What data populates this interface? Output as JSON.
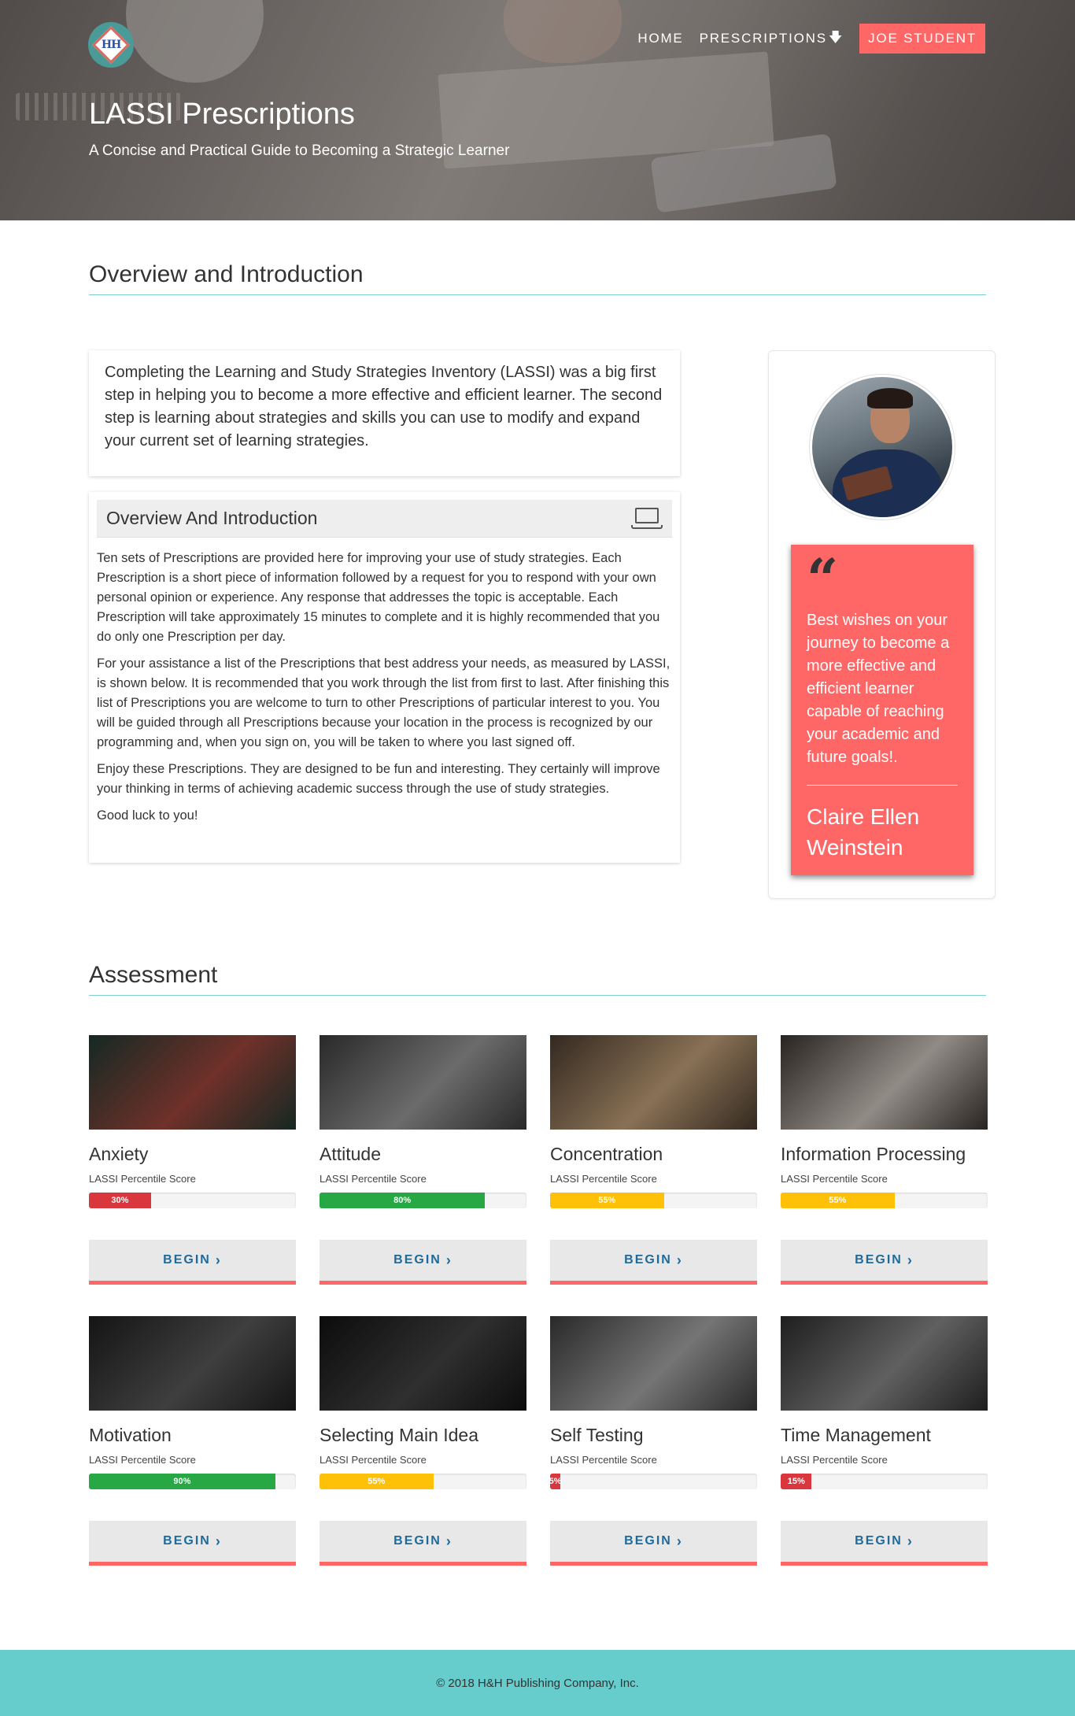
{
  "brand": {
    "logo_text": "HH",
    "logo_icon": "hh-logo-icon"
  },
  "nav": {
    "home": "HOME",
    "prescriptions": "PRESCRIPTIONS",
    "prescriptions_icon": "arrow-down-icon",
    "user": "JOE STUDENT"
  },
  "hero": {
    "title": "LASSI Prescriptions",
    "subtitle": "A Concise and Practical Guide to Becoming a Strategic Learner"
  },
  "intro": {
    "section_title": "Overview and Introduction",
    "lead": "Completing the Learning and Study Strategies Inventory (LASSI) was a big first step in helping you to become a more effective and efficient learner. The second step is learning about strategies and skills you can use to modify and expand your current set of learning strategies.",
    "card_title": "Overview And Introduction",
    "card_icon": "laptop-icon",
    "paragraphs": [
      "Ten sets of Prescriptions are provided here for improving your use of study strategies. Each Prescription is a short piece of information followed by a request for you to respond with your own personal opinion or experience. Any response that addresses the topic is acceptable. Each Prescription will take approximately 15 minutes to complete and it is highly recommended that you do only one Prescription per day.",
      "For your assistance a list of the Prescriptions that best address your needs, as measured by LASSI, is shown below. It is recommended that you work through the list from first to last. After finishing this list of Prescriptions you are welcome to turn to other Prescriptions of particular interest to you. You will be guided through all Prescriptions because your location in the process is recognized by our programming and, when you sign on, you will be taken to where you last signed off.",
      "Enjoy these Prescriptions. They are designed to be fun and interesting. They certainly will improve your thinking in terms of achieving academic success through the use of study strategies.",
      "Good luck to you!"
    ]
  },
  "quote": {
    "icon": "quote-icon",
    "mark": "“",
    "text": "Best wishes on your journey to become a more effective and efficient learner capable of reaching your academic and future goals!.",
    "author": "Claire Ellen Weinstein"
  },
  "assessment": {
    "section_title": "Assessment",
    "score_label": "LASSI Percentile Score",
    "begin_label": "BEGIN",
    "chevron_icon": "chevron-right-icon",
    "items": [
      {
        "name": "Anxiety",
        "score": 30,
        "score_text": "30%",
        "color": "#d9363e",
        "thumb": [
          "#1f3a33",
          "#a0473c"
        ]
      },
      {
        "name": "Attitude",
        "score": 80,
        "score_text": "80%",
        "color": "#28a745",
        "thumb": [
          "#3b3b3b",
          "#9a9a9a"
        ]
      },
      {
        "name": "Concentration",
        "score": 55,
        "score_text": "55%",
        "color": "#ffc107",
        "thumb": [
          "#4a3b2e",
          "#c4a27a"
        ]
      },
      {
        "name": "Information Processing",
        "score": 55,
        "score_text": "55%",
        "color": "#ffc107",
        "thumb": [
          "#3a3430",
          "#d0c8c0"
        ]
      },
      {
        "name": "Motivation",
        "score": 90,
        "score_text": "90%",
        "color": "#28a745",
        "thumb": [
          "#1e1e1e",
          "#5a5a5a"
        ]
      },
      {
        "name": "Selecting Main Idea",
        "score": 55,
        "score_text": "55%",
        "color": "#ffc107",
        "thumb": [
          "#121212",
          "#444444"
        ]
      },
      {
        "name": "Self Testing",
        "score": 5,
        "score_text": "5%",
        "color": "#d9363e",
        "thumb": [
          "#3c3c3c",
          "#a8a8a8"
        ]
      },
      {
        "name": "Time Management",
        "score": 15,
        "score_text": "15%",
        "color": "#d9363e",
        "thumb": [
          "#2c2c2c",
          "#8a8a8a"
        ]
      }
    ]
  },
  "footer": {
    "text": "© 2018 H&H Publishing Company, Inc."
  }
}
